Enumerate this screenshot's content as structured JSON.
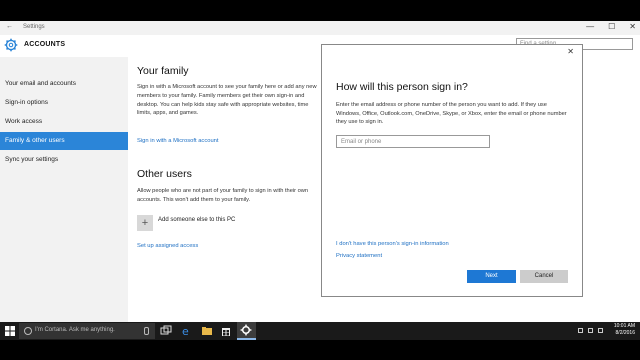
{
  "window": {
    "title": "Settings",
    "back_glyph": "←",
    "minimize_glyph": "—",
    "maximize_glyph": "☐",
    "close_glyph": "✕"
  },
  "header": {
    "section": "ACCOUNTS",
    "search_placeholder": "Find a setting"
  },
  "sidebar": {
    "items": [
      {
        "label": "Your email and accounts",
        "active": false
      },
      {
        "label": "Sign-in options",
        "active": false
      },
      {
        "label": "Work access",
        "active": false
      },
      {
        "label": "Family & other users",
        "active": true
      },
      {
        "label": "Sync your settings",
        "active": false
      }
    ]
  },
  "main": {
    "family_heading": "Your family",
    "family_text": "Sign in with a Microsoft account to see your family here or add any new members to your family. Family members get their own sign-in and desktop. You can help kids stay safe with appropriate websites, time limits, apps, and games.",
    "family_link": "Sign in with a Microsoft account",
    "other_heading": "Other users",
    "other_text": "Allow people who are not part of your family to sign in with their own accounts. This won't add them to your family.",
    "add_label": "Add someone else to this PC",
    "assigned_link": "Set up assigned access"
  },
  "dialog": {
    "title": "How will this person sign in?",
    "text": "Enter the email address or phone number of the person you want to add. If they use Windows, Office, Outlook.com, OneDrive, Skype, or Xbox, enter the email or phone number they use to sign in.",
    "email_placeholder": "Email or phone",
    "no_info_link": "I don't have this person's sign-in information",
    "privacy_link": "Privacy statement",
    "next_label": "Next",
    "cancel_label": "Cancel",
    "close_glyph": "✕"
  },
  "taskbar": {
    "cortana_placeholder": "I'm Cortana. Ask me anything.",
    "time": "10:01 AM",
    "date": "8/2/2016"
  },
  "colors": {
    "accent": "#2b85d8",
    "link": "#1d6fc3",
    "next_button": "#1e78d4"
  }
}
